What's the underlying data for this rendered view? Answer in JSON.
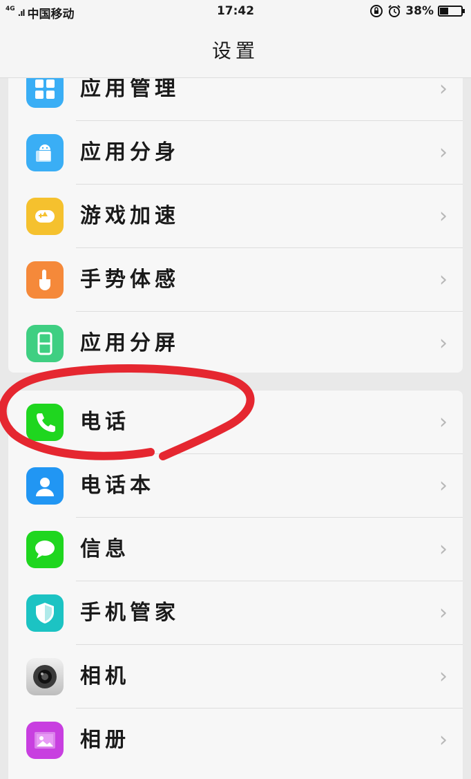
{
  "status": {
    "network": "4G",
    "carrier": "中国移动",
    "time": "17:42",
    "battery_pct": "38%",
    "battery_level": 0.38
  },
  "nav": {
    "title": "设置"
  },
  "group1": [
    {
      "label": "应用管理",
      "icon": "apps-grid-icon",
      "color": "#3aaef5"
    },
    {
      "label": "应用分身",
      "icon": "android-clone-icon",
      "color": "#3aaef5"
    },
    {
      "label": "游戏加速",
      "icon": "game-rocket-icon",
      "color": "#f5c12e"
    },
    {
      "label": "手势体感",
      "icon": "gesture-hand-icon",
      "color": "#f5893a"
    },
    {
      "label": "应用分屏",
      "icon": "split-screen-icon",
      "color": "#3fcf82"
    }
  ],
  "group2": [
    {
      "label": "电话",
      "icon": "phone-icon",
      "color": "#1fd61f"
    },
    {
      "label": "电话本",
      "icon": "contacts-icon",
      "color": "#2196f3"
    },
    {
      "label": "信息",
      "icon": "message-icon",
      "color": "#1fd61f"
    },
    {
      "label": "手机管家",
      "icon": "shield-icon",
      "color": "#1cc3c3"
    },
    {
      "label": "相机",
      "icon": "camera-icon",
      "color": "#cfcfcf"
    },
    {
      "label": "相册",
      "icon": "gallery-icon",
      "color": "#c83fe0"
    }
  ],
  "chevron": "›"
}
